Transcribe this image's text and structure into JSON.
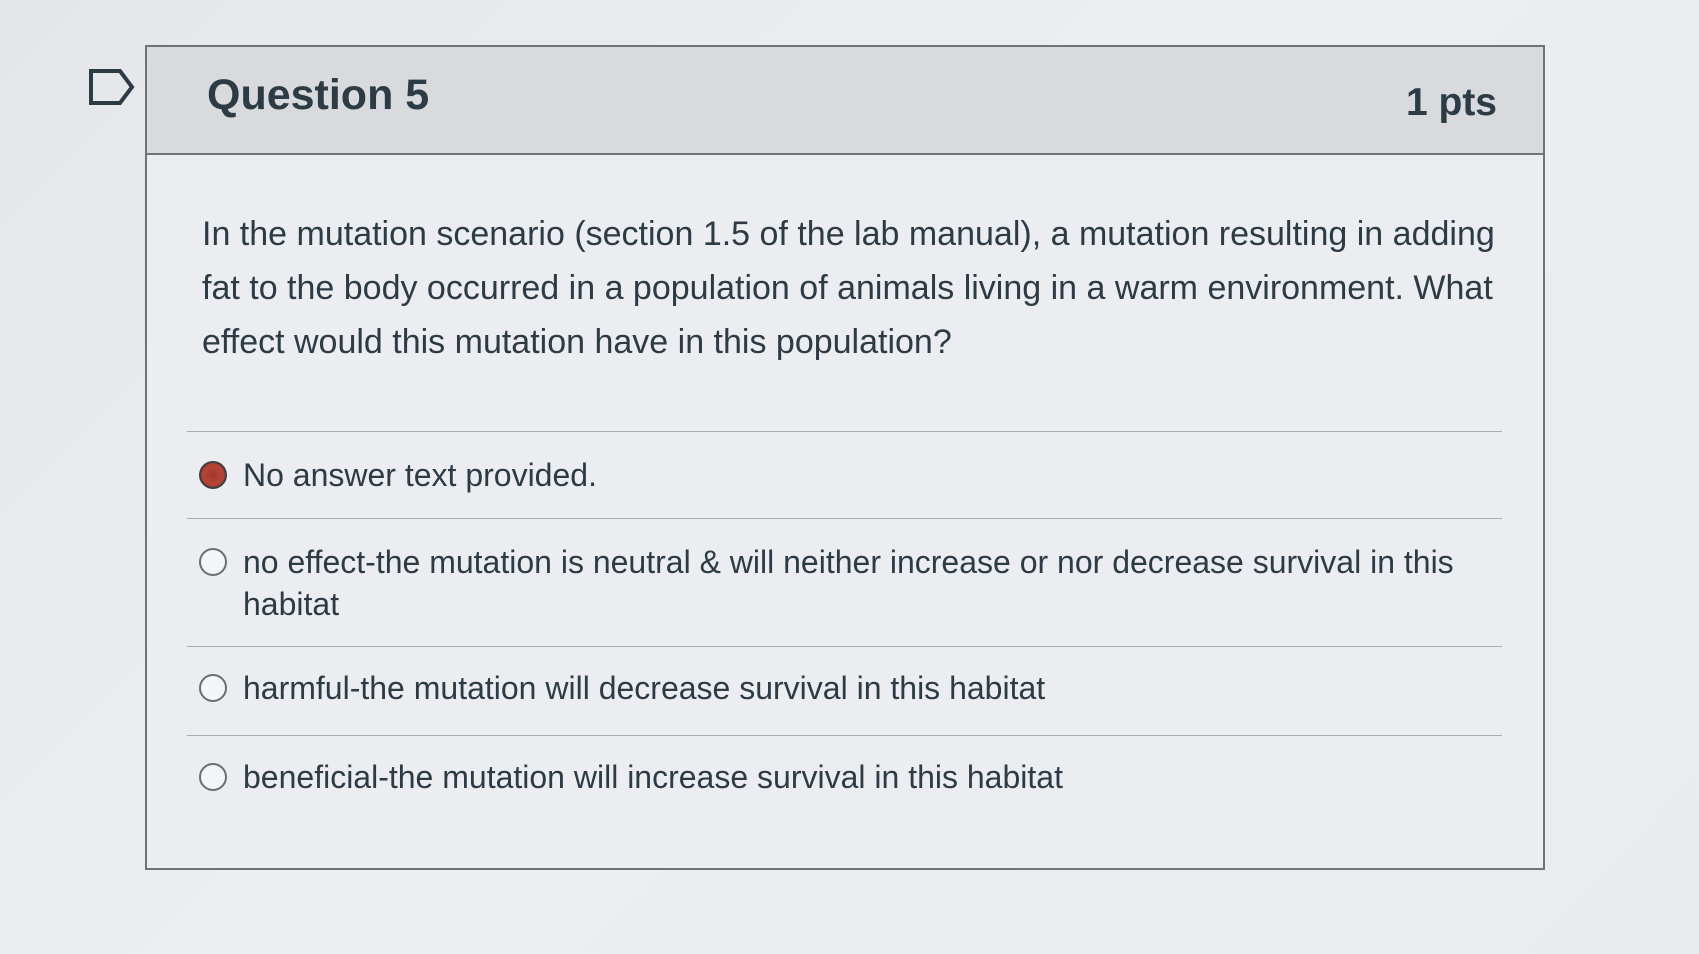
{
  "question": {
    "title": "Question 5",
    "points": "1 pts",
    "text": "In the mutation scenario (section 1.5 of the lab manual), a mutation resulting in adding fat to the body occurred in a population of animals living in a warm environment. What effect would this mutation have in this population?"
  },
  "answers": [
    {
      "label": "No answer text provided.",
      "selected": true
    },
    {
      "label": "no effect-the mutation is neutral & will neither increase or nor decrease survival in this habitat",
      "selected": false
    },
    {
      "label": "harmful-the mutation will decrease survival in this habitat",
      "selected": false
    },
    {
      "label": "beneficial-the mutation will increase survival in this habitat",
      "selected": false
    }
  ],
  "colors": {
    "selected_radio": "#a2382f",
    "header_bg": "#d8dadd",
    "text": "#2d3b45"
  },
  "icons": {
    "flag": "flag-question-icon"
  }
}
